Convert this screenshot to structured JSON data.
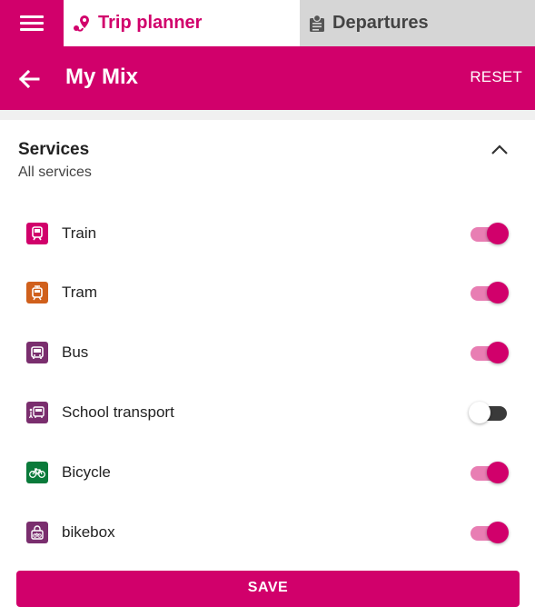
{
  "tabs": {
    "trip_planner": "Trip planner",
    "departures": "Departures"
  },
  "header": {
    "title": "My Mix",
    "reset_label": "RESET"
  },
  "section": {
    "title": "Services",
    "subtitle": "All services"
  },
  "services": [
    {
      "label": "Train",
      "icon": "train-icon",
      "color": "#d1006b",
      "enabled": true
    },
    {
      "label": "Tram",
      "icon": "tram-icon",
      "color": "#d0601c",
      "enabled": true
    },
    {
      "label": "Bus",
      "icon": "bus-icon",
      "color": "#7a2e6e",
      "enabled": true
    },
    {
      "label": "School transport",
      "icon": "school-bus-icon",
      "color": "#7a2e6e",
      "enabled": false
    },
    {
      "label": "Bicycle",
      "icon": "bicycle-icon",
      "color": "#0a7a3a",
      "enabled": true
    },
    {
      "label": "bikebox",
      "icon": "bikebox-icon",
      "color": "#7a2e6e",
      "enabled": true
    }
  ],
  "save_label": "SAVE",
  "colors": {
    "accent": "#d1006b",
    "toggle_track_on": "#e87eb3",
    "toggle_track_off": "#3a3a3a"
  }
}
